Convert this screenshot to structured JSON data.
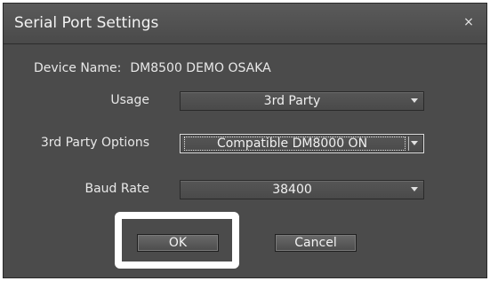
{
  "dialog": {
    "title": "Serial Port Settings",
    "close_glyph": "×"
  },
  "device": {
    "label": "Device Name:",
    "value": "DM8500 DEMO OSAKA"
  },
  "usage": {
    "label": "Usage",
    "value": "3rd Party"
  },
  "third_party_options": {
    "label": "3rd Party Options",
    "value": "Compatible DM8000 ON"
  },
  "baud_rate": {
    "label": "Baud Rate",
    "value": "38400"
  },
  "buttons": {
    "ok": "OK",
    "cancel": "Cancel"
  },
  "colors": {
    "dialog_bg": "#4b4b4b",
    "highlight_frame": "#ffffff"
  },
  "icons": [
    "close-icon",
    "dropdown-arrow-icon"
  ]
}
